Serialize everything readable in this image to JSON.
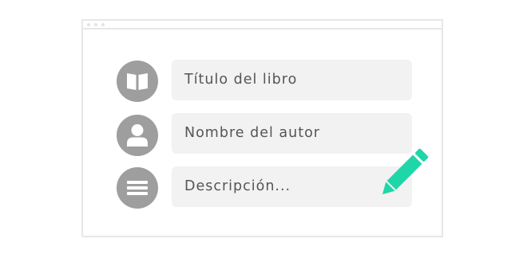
{
  "form": {
    "fields": [
      {
        "icon": "book-icon",
        "placeholder": "Título del libro"
      },
      {
        "icon": "user-icon",
        "placeholder": "Nombre del autor"
      },
      {
        "icon": "lines-icon",
        "placeholder": "Descripción..."
      }
    ],
    "edit_icon": "pencil-icon"
  },
  "colors": {
    "icon_bg": "#9e9e9e",
    "field_bg": "#f2f2f2",
    "text": "#555555",
    "accent": "#1fd6a8",
    "window_border": "#e7e7e7"
  }
}
